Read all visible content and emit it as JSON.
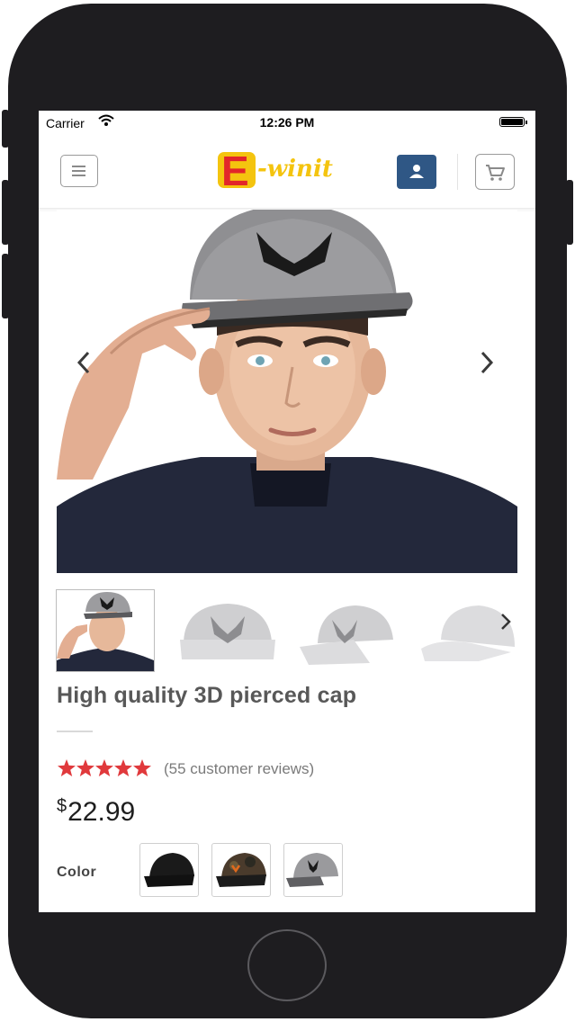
{
  "status_bar": {
    "carrier": "Carrier",
    "time": "12:26 PM"
  },
  "header": {
    "logo_letter": "E",
    "logo_text": "-winit"
  },
  "product": {
    "title": "High quality 3D pierced cap",
    "rating": 5,
    "reviews": "(55 customer reviews)",
    "currency": "$",
    "price": "22.99",
    "color_label": "Color"
  },
  "colors": {
    "brand_yellow": "#f4c40f",
    "brand_red": "#e2262a",
    "user_button": "#2f5785",
    "star": "#e0393c"
  },
  "icons": [
    "menu-icon",
    "user-icon",
    "cart-icon",
    "chevron-left-icon",
    "chevron-right-icon",
    "wifi-icon",
    "battery-icon",
    "star-icon"
  ]
}
